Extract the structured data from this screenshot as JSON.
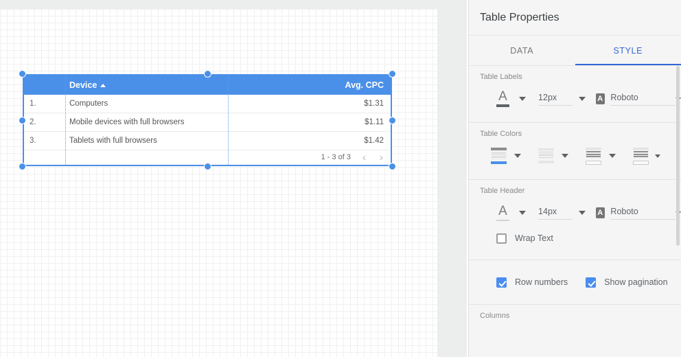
{
  "canvas": {
    "table_widget": {
      "columns": [
        "Device",
        "Avg. CPC"
      ],
      "sort_indicator": "sort-ascending-icon",
      "rows": [
        {
          "num": "1.",
          "device": "Computers",
          "cpc": "$1.31"
        },
        {
          "num": "2.",
          "device": "Mobile devices with full browsers",
          "cpc": "$1.11"
        },
        {
          "num": "3.",
          "device": "Tablets with full browsers",
          "cpc": "$1.42"
        }
      ],
      "pagination": {
        "range_text": "1 - 3 of 3",
        "prev_glyph": "‹",
        "next_glyph": "›"
      }
    }
  },
  "panel": {
    "title": "Table Properties",
    "tabs": [
      {
        "label": "DATA",
        "active": false
      },
      {
        "label": "STYLE",
        "active": true
      }
    ],
    "accent_color": "#3367d6",
    "table_labels": {
      "section_label": "Table Labels",
      "font_size": "12px",
      "font_family": "Roboto"
    },
    "table_colors": {
      "section_label": "Table Colors",
      "swatches": [
        "header-color-icon",
        "odd-row-color-icon",
        "even-row-color-icon",
        "footer-color-icon"
      ]
    },
    "table_header": {
      "section_label": "Table Header",
      "font_size": "14px",
      "font_family": "Roboto",
      "wrap_text_label": "Wrap Text",
      "wrap_text_checked": false
    },
    "options": {
      "row_numbers_label": "Row numbers",
      "row_numbers_checked": true,
      "show_pagination_label": "Show pagination",
      "show_pagination_checked": true
    },
    "columns_section_label": "Columns"
  }
}
